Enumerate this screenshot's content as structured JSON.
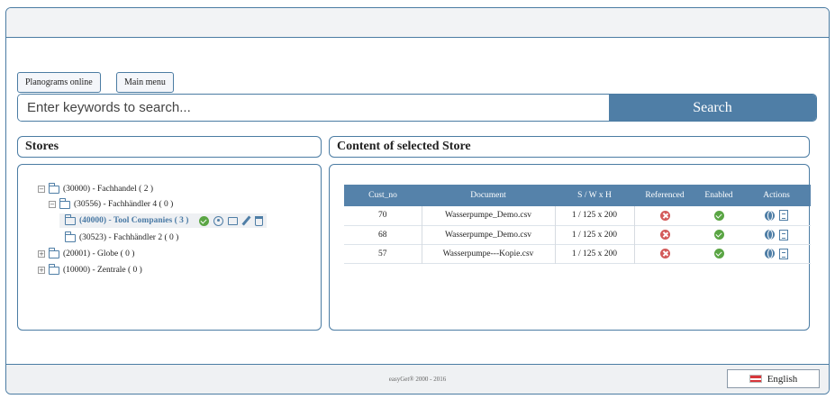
{
  "nav": {
    "planograms_online": "Planograms online",
    "main_menu": "Main menu"
  },
  "search": {
    "placeholder": "Enter keywords to search...",
    "button_label": "Search"
  },
  "stores_panel": {
    "title": "Stores",
    "tree": [
      {
        "toggle": "−",
        "label": "(30000) - Fachhandel ( 2 )"
      },
      {
        "toggle": "−",
        "label": "(30556) - Fachhändler 4 ( 0 )"
      },
      {
        "toggle": "",
        "label": "(40000) - Tool Companies ( 3 )",
        "selected": true
      },
      {
        "toggle": "",
        "label": "(30523) - Fachhändler 2 ( 0 )"
      },
      {
        "toggle": "+",
        "label": "(20001) - Globe ( 0 )"
      },
      {
        "toggle": "+",
        "label": "(10000) - Zentrale ( 0 )"
      }
    ]
  },
  "content_panel": {
    "title": "Content of selected Store",
    "columns": [
      "Cust_no",
      "Document",
      "S / W x H",
      "Referenced",
      "Enabled",
      "Actions"
    ],
    "rows": [
      {
        "cust_no": "70",
        "document": "Wasserpumpe_Demo.csv",
        "dims": "1 / 125 x 200"
      },
      {
        "cust_no": "68",
        "document": "Wasserpumpe_Demo.csv",
        "dims": "1 / 125 x 200"
      },
      {
        "cust_no": "57",
        "document": "Wasserpumpe---Kopie.csv",
        "dims": "1 / 125 x 200"
      }
    ]
  },
  "footer": {
    "copyright": "easyGet® 2000 - 2016",
    "language": "English"
  },
  "colors": {
    "accent": "#4f7ea6",
    "ok": "#5aa544",
    "error": "#d35a5a"
  }
}
